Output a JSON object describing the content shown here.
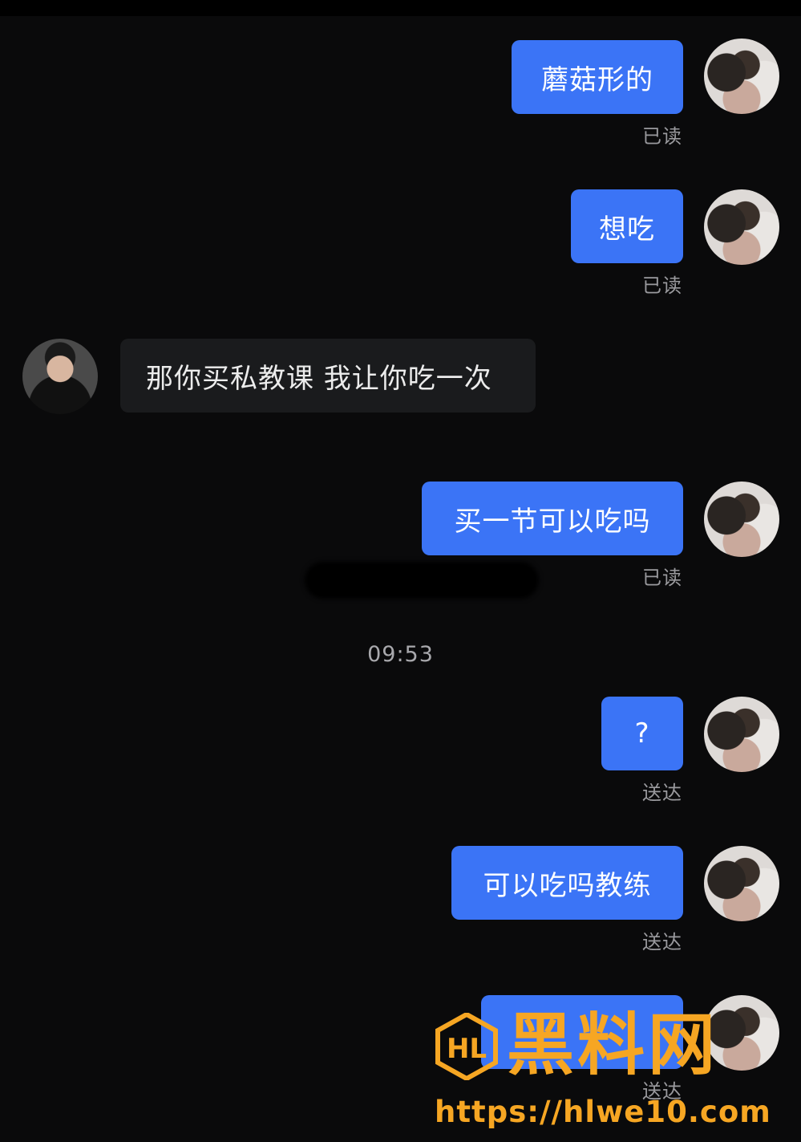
{
  "messages": [
    {
      "sender": "me",
      "text": "蘑菇形的",
      "status": "已读"
    },
    {
      "sender": "me",
      "text": "想吃",
      "status": "已读"
    },
    {
      "sender": "them",
      "text": "那你买私教课 我让你吃一次"
    },
    {
      "sender": "me",
      "text": "买一节可以吃吗",
      "status": "已读"
    },
    {
      "sender": "me",
      "text": "?",
      "status": "送达"
    },
    {
      "sender": "me",
      "text": "可以吃吗教练",
      "status": "送达"
    },
    {
      "sender": "me",
      "text": "",
      "status": "送达"
    }
  ],
  "timestamp": "09:53",
  "watermark": {
    "title": "黑料网",
    "url": "https://hlwe10.com",
    "logo_text": "HL",
    "color": "#f6a623"
  },
  "colors": {
    "background": "#0a0a0b",
    "my_bubble": "#3b74f6",
    "their_bubble": "#1a1b1d",
    "status_text": "#9a9a9e"
  }
}
